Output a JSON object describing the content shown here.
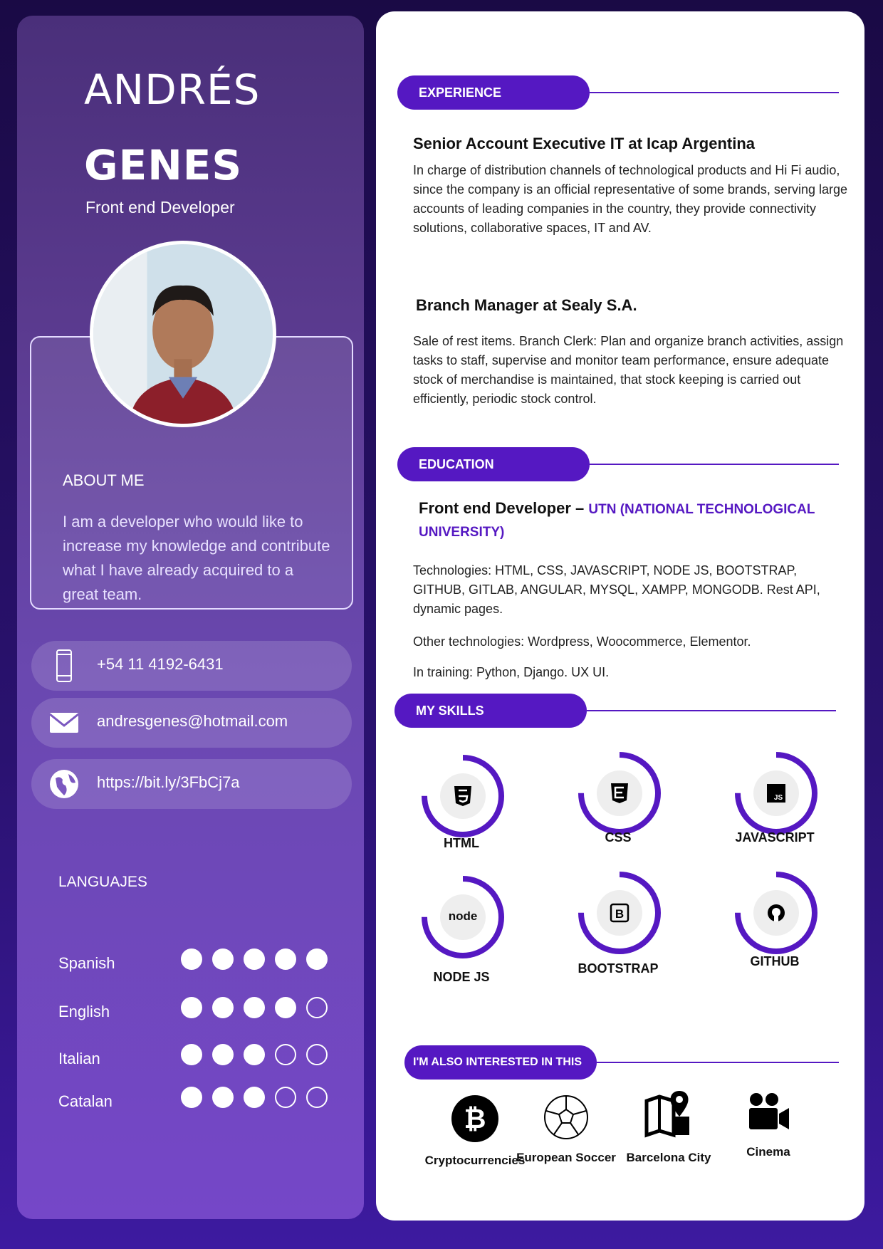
{
  "profile": {
    "first_name": "ANDRÉS",
    "last_name": "GENES",
    "role": "Front end Developer"
  },
  "about": {
    "title": "ABOUT ME",
    "text": "I am a developer who would like to increase my knowledge and contribute what I have already acquired to a great team."
  },
  "contacts": [
    {
      "icon": "phone-icon",
      "text": "+54 11 4192-6431"
    },
    {
      "icon": "mail-icon",
      "text": "andresgenes@hotmail.com"
    },
    {
      "icon": "globe-icon",
      "text": "https://bit.ly/3FbCj7a"
    }
  ],
  "languages": {
    "title": "LANGUAJES",
    "items": [
      {
        "name": "Spanish",
        "level": 5,
        "max": 5
      },
      {
        "name": "English",
        "level": 4,
        "max": 5
      },
      {
        "name": "Italian",
        "level": 3,
        "max": 5
      },
      {
        "name": "Catalan",
        "level": 3,
        "max": 5
      }
    ]
  },
  "experience": {
    "title": "EXPERIENCE",
    "jobs": [
      {
        "title": "Senior Account Executive IT at Icap Argentina",
        "desc": "In charge of distribution channels of technological products and Hi Fi audio, since the company is an official representative of some brands, serving large accounts of leading companies in the country, they provide connectivity solutions, collaborative spaces, IT and AV."
      },
      {
        "title": "Branch Manager at Sealy S.A.",
        "desc": "Sale of rest items. Branch Clerk: Plan and organize branch activities, assign tasks to staff, supervise and monitor team performance, ensure adequate stock of merchandise is maintained, that stock keeping is carried out efficiently, periodic stock control."
      }
    ]
  },
  "education": {
    "title": "EDUCATION",
    "degree": "Front end Developer –",
    "institution": "UTN (NATIONAL TECHNOLOGICAL UNIVERSITY)",
    "technologies": "Technologies: HTML, CSS, JAVASCRIPT, NODE JS, BOOTSTRAP, GITHUB, GITLAB, ANGULAR, MYSQL, XAMPP, MONGODB. Rest API, dynamic pages.",
    "other": "Other technologies: Wordpress, Woocommerce, Elementor.",
    "training": "In training: Python, Django. UX UI."
  },
  "skills": {
    "title": "MY SKILLS",
    "accent": "#5518c2",
    "items": [
      {
        "name": "HTML",
        "icon": "html5-icon",
        "level": 0.75
      },
      {
        "name": "CSS",
        "icon": "css3-icon",
        "level": 0.75
      },
      {
        "name": "JAVASCRIPT",
        "icon": "javascript-icon",
        "level": 0.75
      },
      {
        "name": "NODE JS",
        "icon": "nodejs-icon",
        "level": 0.75
      },
      {
        "name": "BOOTSTRAP",
        "icon": "bootstrap-icon",
        "level": 0.75
      },
      {
        "name": "GITHUB",
        "icon": "github-icon",
        "level": 0.75
      }
    ]
  },
  "interests": {
    "title": "I'M ALSO INTERESTED IN THIS",
    "items": [
      {
        "name": "Cryptocurrencies",
        "icon": "bitcoin-icon"
      },
      {
        "name": "European Soccer",
        "icon": "soccer-ball-icon"
      },
      {
        "name": "Barcelona City",
        "icon": "map-pin-icon"
      },
      {
        "name": "Cinema",
        "icon": "video-camera-icon"
      }
    ]
  }
}
